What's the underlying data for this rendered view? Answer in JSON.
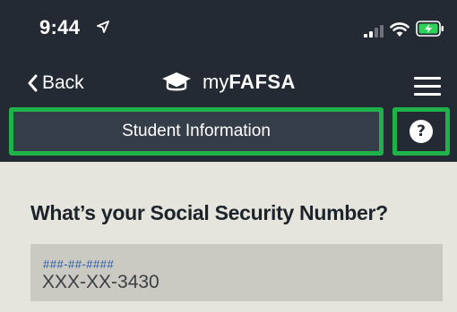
{
  "status_bar": {
    "time": "9:44",
    "icons": [
      "location-arrow-icon",
      "cellular-signal-icon",
      "wifi-icon",
      "battery-charging-icon"
    ]
  },
  "nav": {
    "back_label": "Back",
    "brand_prefix": "my",
    "brand_suffix": "FAFSA",
    "icons": [
      "chevron-left-icon",
      "graduation-cap-icon",
      "hamburger-menu-icon"
    ]
  },
  "section": {
    "title": "Student Information",
    "help_label": "?"
  },
  "form": {
    "question": "What’s your Social Security Number?",
    "ssn_field": {
      "placeholder": "###-##-####",
      "value": "XXX-XX-3430"
    }
  },
  "colors": {
    "header_bg": "#232a33",
    "section_title_bg": "#353d48",
    "highlight_border": "#1fb24a",
    "page_bg": "#e6e5dd",
    "field_bg": "#cacac2",
    "placeholder_text": "#2a5aa6",
    "battery_fill": "#2fd158"
  }
}
